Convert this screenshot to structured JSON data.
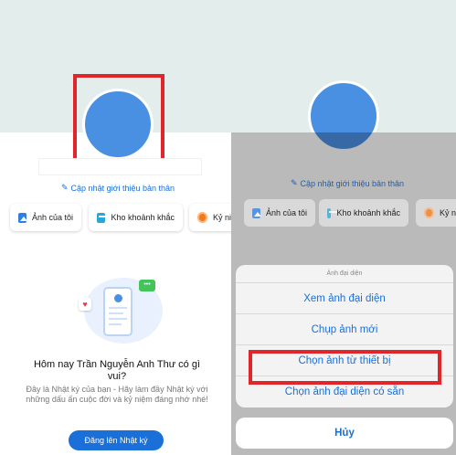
{
  "left": {
    "bio_link": "Cập nhật giới thiệu bản thân",
    "chips": [
      "Ảnh của tôi",
      "Kho khoảnh khắc",
      "Kỷ niệ"
    ],
    "diary_title": "Hôm nay Trần Nguyễn Anh Thư có gì vui?",
    "diary_desc": "Đây là Nhật ký của bạn - Hãy làm đầy Nhật ký với những dấu ấn cuộc đời và kỷ niệm đáng nhớ nhé!",
    "diary_button": "Đăng lên Nhật ký"
  },
  "right": {
    "bio_link": "Cập nhật giới thiệu bản thân",
    "chips": [
      "Ảnh của tôi",
      "Kho khoảnh khắc",
      "Kỷ niệ"
    ],
    "sheet": {
      "header": "Ảnh đại diện",
      "items": [
        "Xem ảnh đại diện",
        "Chụp ảnh mới",
        "Chọn ảnh từ thiết bị",
        "Chọn ảnh đại diện có sẵn"
      ],
      "cancel": "Hủy"
    }
  },
  "colors": {
    "accent": "#1a6fd8",
    "avatar": "#4a90e2",
    "highlight": "#e1262b",
    "cover": "#e3eeec"
  }
}
